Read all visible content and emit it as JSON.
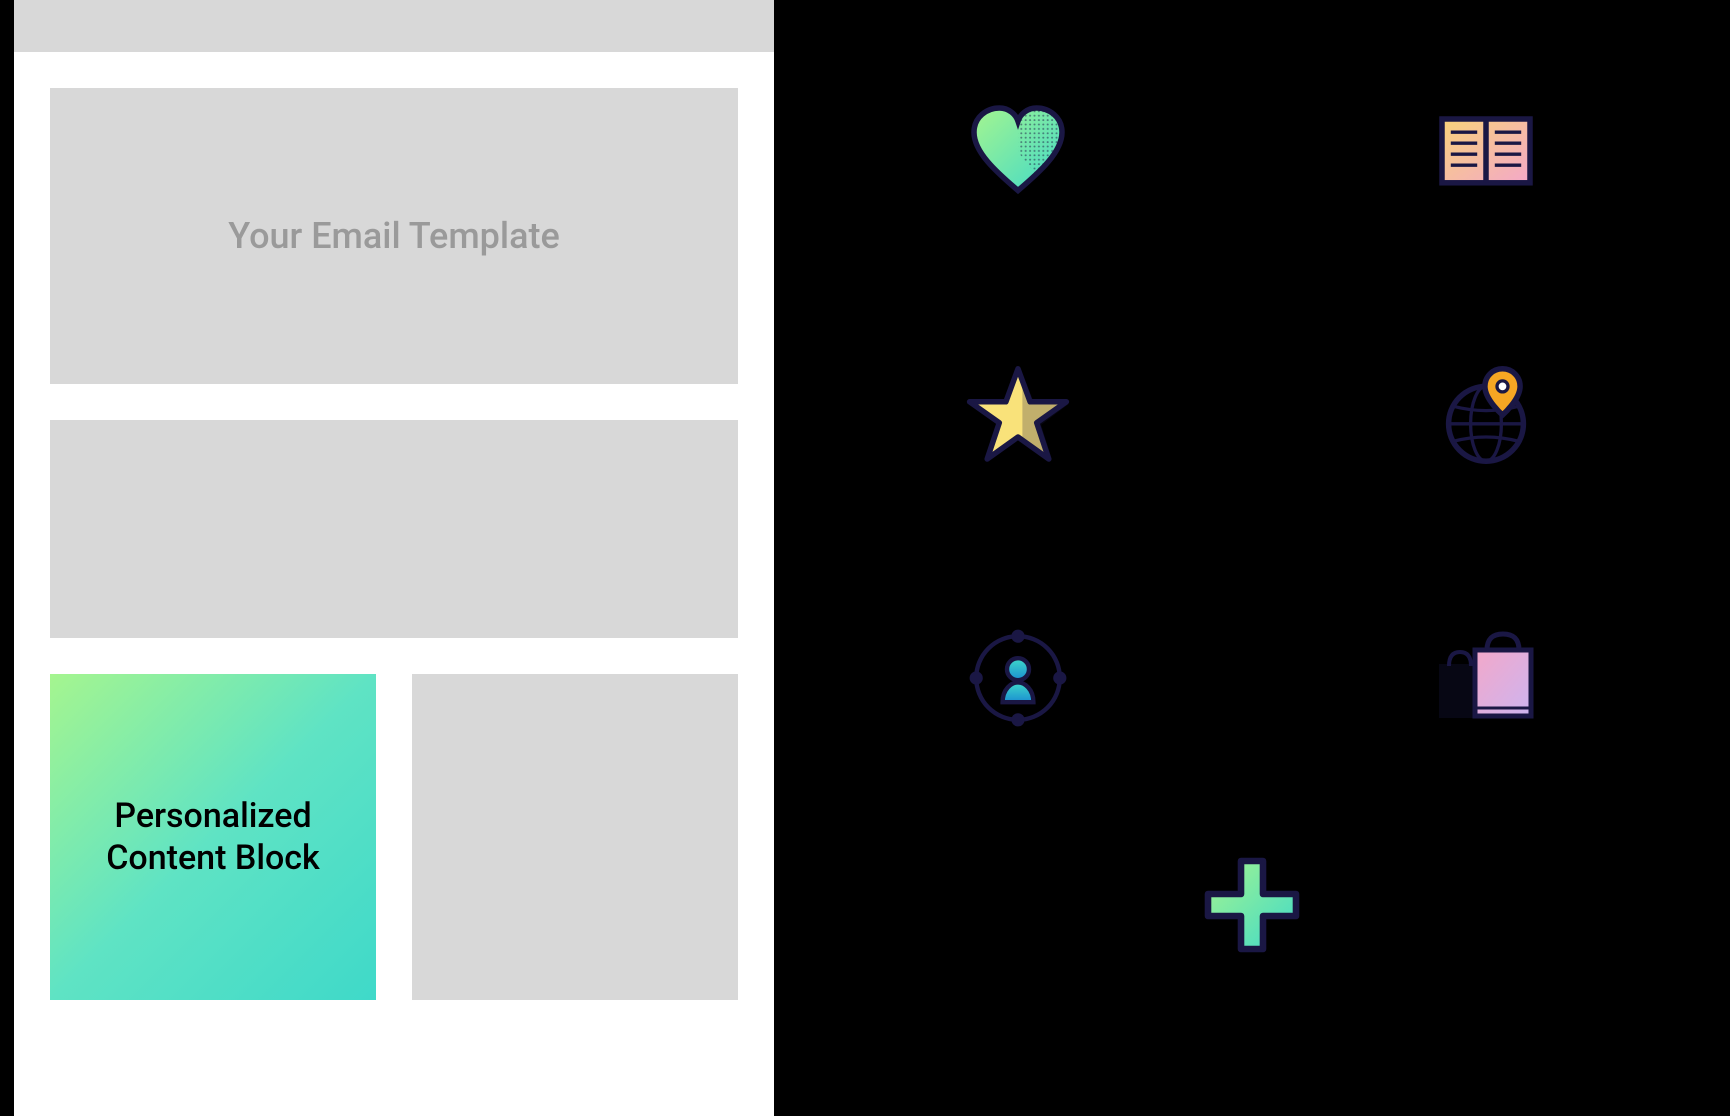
{
  "left": {
    "hero_label": "Your Email Template",
    "personalized_label": "Personalized\nContent Block"
  },
  "icons": {
    "heart": "heart-icon",
    "book": "book-icon",
    "star": "star-icon",
    "globe_pin": "globe-pin-icon",
    "profile_orbit": "profile-orbit-icon",
    "shopping_bags": "shopping-bags-icon",
    "plus": "plus-icon"
  },
  "colors": {
    "grad_green": "#a5f58f",
    "grad_teal": "#3fd9c9",
    "navy": "#1a1744",
    "yellow": "#f9e27a",
    "blue": "#1a8ed1",
    "pink": "#f3a8c9",
    "lavender": "#cdb4f0",
    "orange": "#f6a623"
  }
}
